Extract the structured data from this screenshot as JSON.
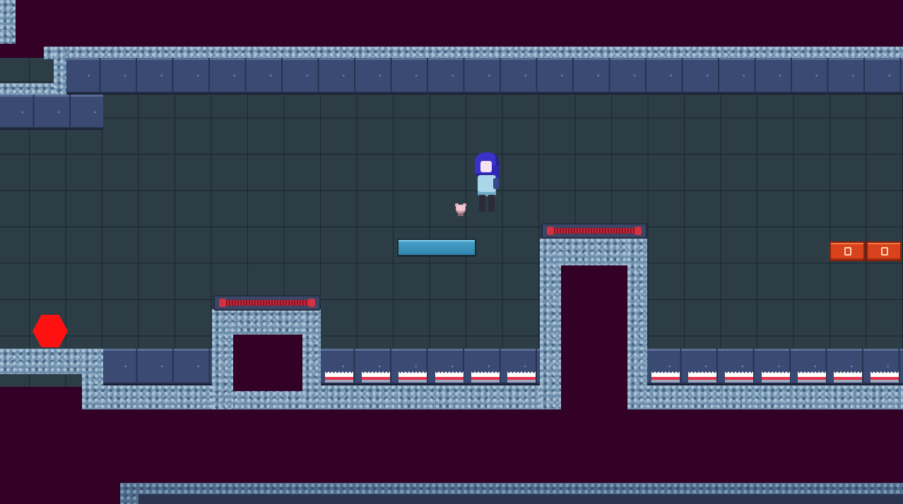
{
  "colors": {
    "void": "#330026",
    "interior": "#2c3d45",
    "rock": "#6d8eab",
    "steel_panel": "#3a4a72",
    "spring_red": "#c2263a",
    "spike_white": "#ffffff",
    "orange_block": "#d8421d",
    "hexagon_red": "#ff1111",
    "moving_platform": "#4aa3c9",
    "player_hair": "#3931c9"
  },
  "icons": {
    "player": "player-character-sprite",
    "companion": "pet-companion-sprite",
    "hazard": "spike-icon",
    "goal": "hexagon-icon",
    "spring": "spring-pad-icon",
    "block": "orange-crate-icon"
  }
}
